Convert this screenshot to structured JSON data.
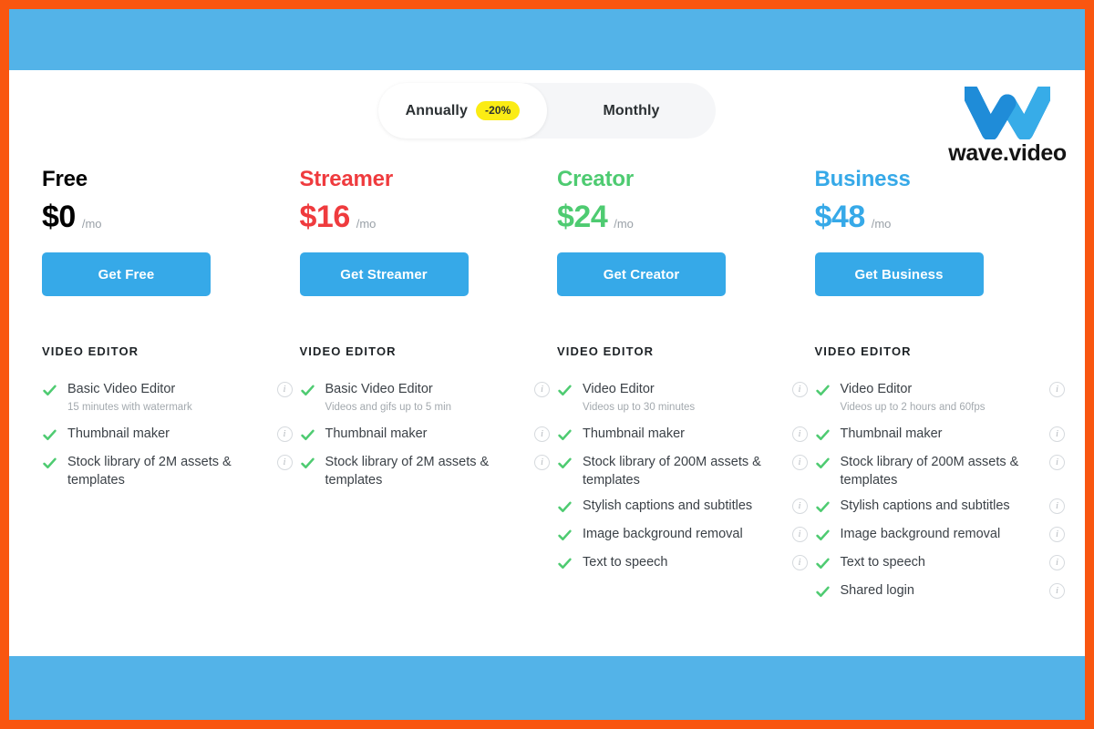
{
  "theme": {
    "frame_color": "#f95610",
    "banner_color": "#53b3e8",
    "cta_color": "#36a9e8",
    "check_color": "#4ecb71",
    "discount_badge_color": "#fbec14"
  },
  "billing_toggle": {
    "annually_label": "Annually",
    "annually_badge": "-20%",
    "monthly_label": "Monthly",
    "selected": "Annually"
  },
  "brand": {
    "name": "wave.video",
    "mark": "wave-w-logo-icon"
  },
  "plans": [
    {
      "name": "Free",
      "name_color": "#9aa1a8",
      "price": "$0",
      "price_color": "#9aa1a8",
      "period": "/mo",
      "cta_label": "Get Free",
      "section_title": "VIDEO EDITOR",
      "features": [
        {
          "label": "Basic Video Editor",
          "sub": "15 minutes with watermark",
          "info": true
        },
        {
          "label": "Thumbnail maker",
          "sub": "",
          "info": true
        },
        {
          "label": "Stock library of 2M assets & templates",
          "sub": "",
          "info": true
        }
      ]
    },
    {
      "name": "Streamer",
      "name_color": "#ef3b3e",
      "price": "$16",
      "price_color": "#ef3b3e",
      "period": "/mo",
      "cta_label": "Get Streamer",
      "section_title": "VIDEO EDITOR",
      "features": [
        {
          "label": "Basic Video Editor",
          "sub": "Videos and gifs up to 5 min",
          "info": true
        },
        {
          "label": "Thumbnail maker",
          "sub": "",
          "info": true
        },
        {
          "label": "Stock library of 2M assets & templates",
          "sub": "",
          "info": true
        }
      ]
    },
    {
      "name": "Creator",
      "name_color": "#4ecb71",
      "price": "$24",
      "price_color": "#4ecb71",
      "period": "/mo",
      "cta_label": "Get Creator",
      "section_title": "VIDEO EDITOR",
      "features": [
        {
          "label": "Video Editor",
          "sub": "Videos up to 30 minutes",
          "info": true
        },
        {
          "label": "Thumbnail maker",
          "sub": "",
          "info": true
        },
        {
          "label": "Stock library of 200M assets & templates",
          "sub": "",
          "info": true
        },
        {
          "label": "Stylish captions and subtitles",
          "sub": "",
          "info": true
        },
        {
          "label": "Image background removal",
          "sub": "",
          "info": true
        },
        {
          "label": "Text to speech",
          "sub": "",
          "info": true
        }
      ]
    },
    {
      "name": "Business",
      "name_color": "#36a9e8",
      "price": "$48",
      "price_color": "#36a9e8",
      "period": "/mo",
      "cta_label": "Get Business",
      "section_title": "VIDEO EDITOR",
      "features": [
        {
          "label": "Video Editor",
          "sub": "Videos up to 2 hours and 60fps",
          "info": true
        },
        {
          "label": "Thumbnail maker",
          "sub": "",
          "info": true
        },
        {
          "label": "Stock library of 200M assets & templates",
          "sub": "",
          "info": true
        },
        {
          "label": "Stylish captions and subtitles",
          "sub": "",
          "info": true
        },
        {
          "label": "Image background removal",
          "sub": "",
          "info": true
        },
        {
          "label": "Text to speech",
          "sub": "",
          "info": true
        },
        {
          "label": "Shared login",
          "sub": "",
          "info": true
        }
      ]
    }
  ],
  "info_icon_glyph": "i"
}
